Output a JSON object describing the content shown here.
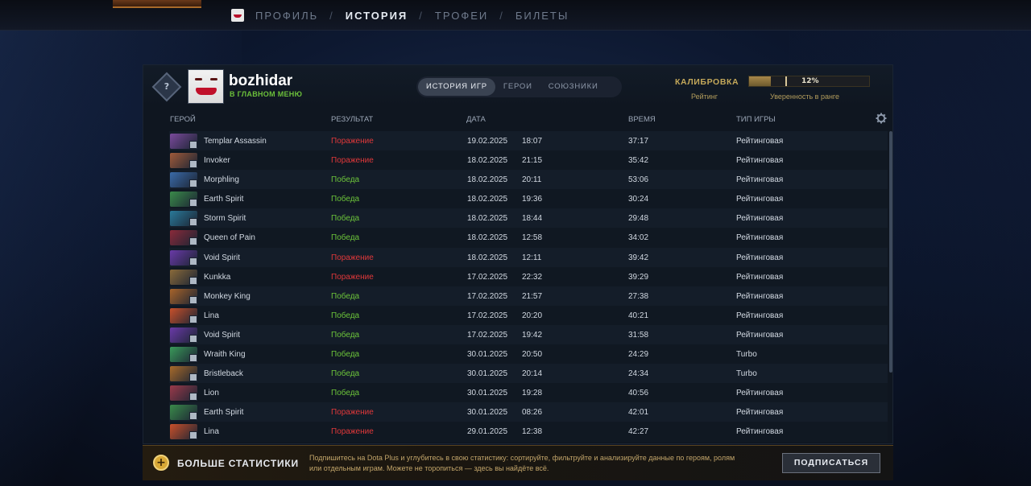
{
  "nav": {
    "items": [
      {
        "label": "ПРОФИЛЬ",
        "active": false
      },
      {
        "label": "ИСТОРИЯ",
        "active": true
      },
      {
        "label": "ТРОФЕИ",
        "active": false
      },
      {
        "label": "БИЛЕТЫ",
        "active": false
      }
    ],
    "separator": "/"
  },
  "profile": {
    "username": "bozhidar",
    "status": "В ГЛАВНОМ МЕНЮ",
    "rank_badge_text": "?"
  },
  "tabs": [
    {
      "label": "ИСТОРИЯ ИГР",
      "active": true
    },
    {
      "label": "ГЕРОИ",
      "active": false
    },
    {
      "label": "СОЮЗНИКИ",
      "active": false
    }
  ],
  "calibration": {
    "label": "КАЛИБРОВКА",
    "percent_text": "12%",
    "progress": 0.12,
    "rating_label": "Рейтинг",
    "confidence_label": "Уверенность в ранге"
  },
  "columns": {
    "hero": "ГЕРОЙ",
    "result": "РЕЗУЛЬТАТ",
    "date": "ДАТА",
    "time": "ВРЕМЯ",
    "mode": "ТИП ИГРЫ"
  },
  "matches": [
    {
      "hero": "Templar Assassin",
      "result": "Поражение",
      "win": false,
      "date": "19.02.2025",
      "clock": "18:07",
      "duration": "37:17",
      "mode": "Рейтинговая",
      "color": "#7a4a9c"
    },
    {
      "hero": "Invoker",
      "result": "Поражение",
      "win": false,
      "date": "18.02.2025",
      "clock": "21:15",
      "duration": "35:42",
      "mode": "Рейтинговая",
      "color": "#a05a3a"
    },
    {
      "hero": "Morphling",
      "result": "Победа",
      "win": true,
      "date": "18.02.2025",
      "clock": "20:11",
      "duration": "53:06",
      "mode": "Рейтинговая",
      "color": "#3a6aa8"
    },
    {
      "hero": "Earth Spirit",
      "result": "Победа",
      "win": true,
      "date": "18.02.2025",
      "clock": "19:36",
      "duration": "30:24",
      "mode": "Рейтинговая",
      "color": "#3a8a4a"
    },
    {
      "hero": "Storm Spirit",
      "result": "Победа",
      "win": true,
      "date": "18.02.2025",
      "clock": "18:44",
      "duration": "29:48",
      "mode": "Рейтинговая",
      "color": "#2a7a9a"
    },
    {
      "hero": "Queen of Pain",
      "result": "Победа",
      "win": true,
      "date": "18.02.2025",
      "clock": "12:58",
      "duration": "34:02",
      "mode": "Рейтинговая",
      "color": "#8a2a3a"
    },
    {
      "hero": "Void Spirit",
      "result": "Поражение",
      "win": false,
      "date": "18.02.2025",
      "clock": "12:11",
      "duration": "39:42",
      "mode": "Рейтинговая",
      "color": "#6a3aa8"
    },
    {
      "hero": "Kunkka",
      "result": "Поражение",
      "win": false,
      "date": "17.02.2025",
      "clock": "22:32",
      "duration": "39:29",
      "mode": "Рейтинговая",
      "color": "#8a6a3a"
    },
    {
      "hero": "Monkey King",
      "result": "Победа",
      "win": true,
      "date": "17.02.2025",
      "clock": "21:57",
      "duration": "27:38",
      "mode": "Рейтинговая",
      "color": "#a8642a"
    },
    {
      "hero": "Lina",
      "result": "Победа",
      "win": true,
      "date": "17.02.2025",
      "clock": "20:20",
      "duration": "40:21",
      "mode": "Рейтинговая",
      "color": "#c8502a"
    },
    {
      "hero": "Void Spirit",
      "result": "Победа",
      "win": true,
      "date": "17.02.2025",
      "clock": "19:42",
      "duration": "31:58",
      "mode": "Рейтинговая",
      "color": "#6a3aa8"
    },
    {
      "hero": "Wraith King",
      "result": "Победа",
      "win": true,
      "date": "30.01.2025",
      "clock": "20:50",
      "duration": "24:29",
      "mode": "Turbo",
      "color": "#3a9a5a"
    },
    {
      "hero": "Bristleback",
      "result": "Победа",
      "win": true,
      "date": "30.01.2025",
      "clock": "20:14",
      "duration": "24:34",
      "mode": "Turbo",
      "color": "#a86a2a"
    },
    {
      "hero": "Lion",
      "result": "Победа",
      "win": true,
      "date": "30.01.2025",
      "clock": "19:28",
      "duration": "40:56",
      "mode": "Рейтинговая",
      "color": "#9a3a4a"
    },
    {
      "hero": "Earth Spirit",
      "result": "Поражение",
      "win": false,
      "date": "30.01.2025",
      "clock": "08:26",
      "duration": "42:01",
      "mode": "Рейтинговая",
      "color": "#3a8a4a"
    },
    {
      "hero": "Lina",
      "result": "Поражение",
      "win": false,
      "date": "29.01.2025",
      "clock": "12:38",
      "duration": "42:27",
      "mode": "Рейтинговая",
      "color": "#c8502a"
    }
  ],
  "promo": {
    "title": "БОЛЬШЕ СТАТИСТИКИ",
    "icon_symbol": "+",
    "text": "Подпишитесь на Dota Plus и углубитесь в свою статистику: сортируйте, фильтруйте и анализируйте данные по героям, ролям или отдельным играм. Можете не торопиться — здесь вы найдёте всё.",
    "button": "ПОДПИСАТЬСЯ"
  }
}
